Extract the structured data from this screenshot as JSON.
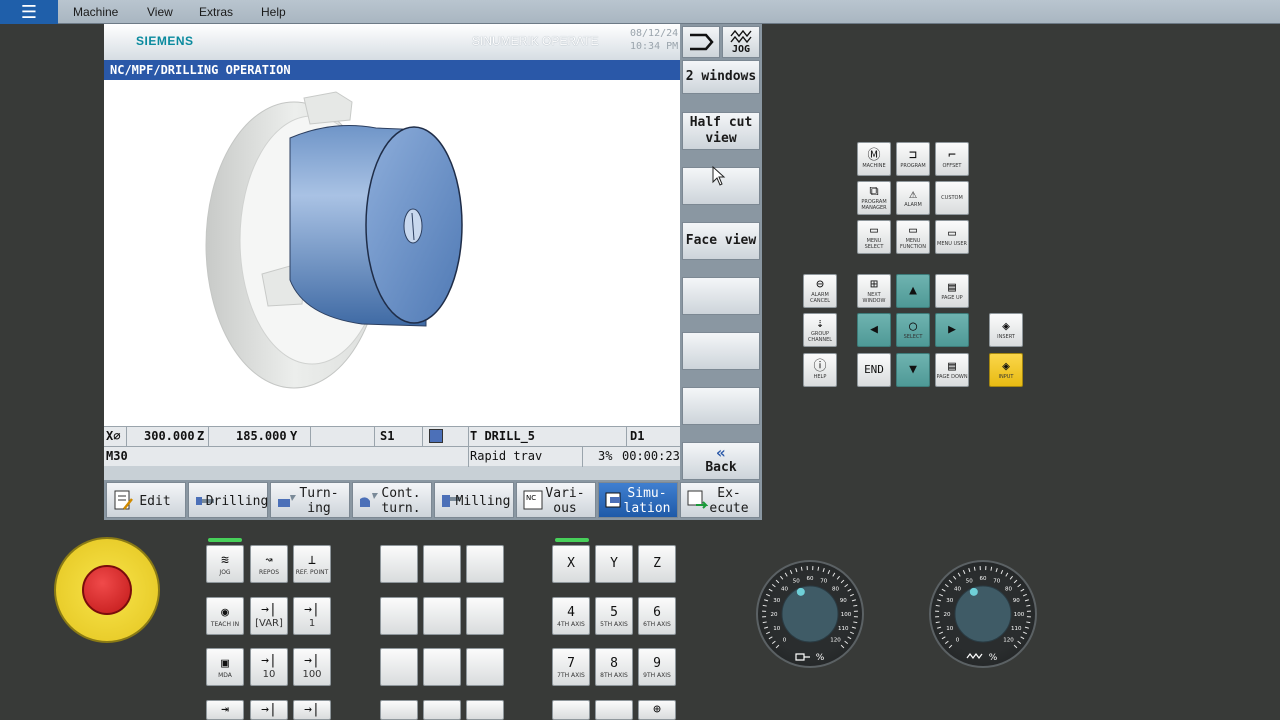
{
  "menubar": {
    "items": [
      "Machine",
      "View",
      "Extras",
      "Help"
    ]
  },
  "header": {
    "brand": "SIEMENS",
    "product": "SINUMERIK OPERATE",
    "date": "08/12/24",
    "time": "10:34 PM",
    "path": "NC/MPF/DRILLING OPERATION"
  },
  "status": {
    "axis_x_label": "X⌀",
    "axis_x_value": "300.000",
    "axis_z_label": "Z",
    "axis_z_value": "185.000",
    "axis_y_label": "Y",
    "spindle": "S1",
    "tool": "T DRILL_5",
    "d": "D1",
    "mcode": "M30",
    "feed_mode": "Rapid trav",
    "override": "3%",
    "elapsed": "00:00:23"
  },
  "vertical_softkeys": {
    "jog_label": "JOG",
    "two_windows": "2 windows",
    "half_cut_view": "Half cut view",
    "face_view": "Face view",
    "back": "Back"
  },
  "horizontal_softkeys": [
    {
      "label": "Edit"
    },
    {
      "label": "Drilling"
    },
    {
      "label": "Turn-ing"
    },
    {
      "label": "Cont. turn."
    },
    {
      "label": "Milling"
    },
    {
      "label": "Vari-ous"
    },
    {
      "label": "Simu-lation",
      "active": true
    },
    {
      "label": "Ex-ecute"
    }
  ],
  "keypad": {
    "machine": "MACHINE",
    "program": "PROGRAM",
    "offset": "OFFSET",
    "program_manager": "PROGRAM MANAGER",
    "alarm": "ALARM",
    "custom": "CUSTOM",
    "menu_select": "MENU SELECT",
    "menu_function": "MENU FUNCTION",
    "menu_user": "MENU USER",
    "alarm_cancel": "ALARM CANCEL",
    "next_window": "NEXT WINDOW",
    "page_up": "PAGE UP",
    "group_channel": "GROUP CHANNEL",
    "select": "SELECT",
    "insert": "INSERT",
    "help": "HELP",
    "end": "END",
    "page_down": "PAGE DOWN",
    "input": "INPUT"
  },
  "mcp": {
    "jog": "JOG",
    "repos": "REPOS",
    "ref_point": "REF. POINT",
    "teach_in": "TEACH IN",
    "var": "[VAR]",
    "inc1": "1",
    "mda": "MDA",
    "inc10": "10",
    "inc100": "100",
    "x": "X",
    "y": "Y",
    "z": "Z",
    "k4": "4",
    "k4s": "4TH AXIS",
    "k5": "5",
    "k5s": "5TH AXIS",
    "k6": "6",
    "k6s": "6TH AXIS",
    "k7": "7",
    "k7s": "7TH AXIS",
    "k8": "8",
    "k8s": "8TH AXIS",
    "k9": "9",
    "k9s": "9TH AXIS"
  },
  "dials": {
    "feed_ticks": [
      "0",
      "10",
      "20",
      "30",
      "40",
      "50",
      "60",
      "70",
      "80",
      "90",
      "100",
      "110",
      "120"
    ],
    "feed_symbol": "%",
    "spindle_ticks": [
      "0",
      "10",
      "20",
      "30",
      "40",
      "50",
      "60",
      "70",
      "80",
      "90",
      "100",
      "110",
      "120"
    ],
    "spindle_symbol": "%",
    "feed_level_percent": 50,
    "spindle_level_percent": 50
  },
  "colors": {
    "accent": "#2a58a8",
    "active_softkey": "#1f5aa8",
    "teal_key": "#5ea6a3",
    "input_key": "#f0c21c",
    "estop": "#d42020"
  }
}
